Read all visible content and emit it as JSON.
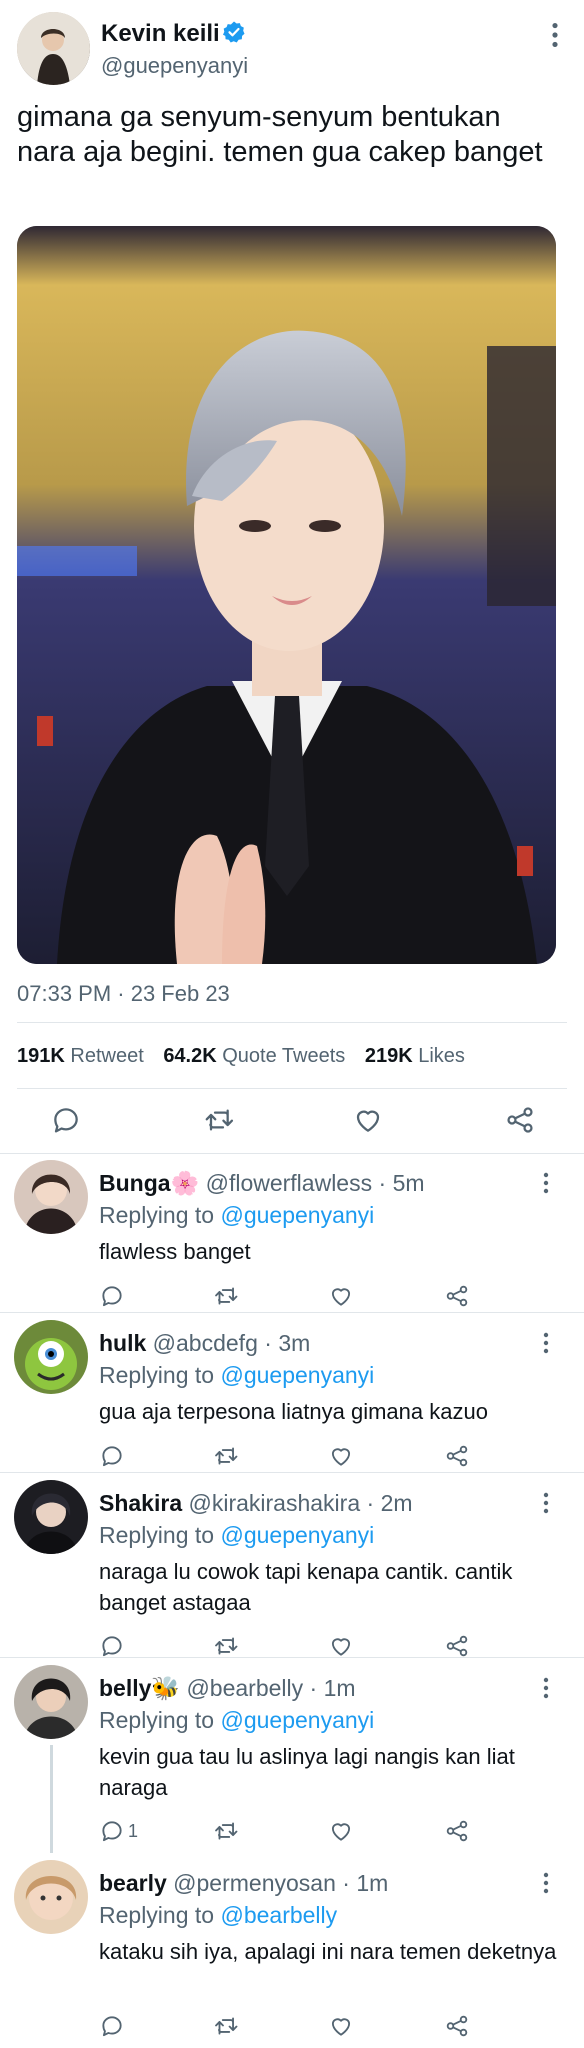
{
  "tweet": {
    "author_name": "Kevin keili",
    "author_handle": "@guepenyanyi",
    "text": "gimana ga senyum-senyum bentukan nara aja begini. temen gua cakep banget",
    "timestamp": "07:33 PM · 23 Feb 23",
    "stats": {
      "retweets": "191K",
      "retweets_label": "Retweet",
      "quotes": "64.2K",
      "quotes_label": "Quote Tweets",
      "likes": "219K",
      "likes_label": "Likes"
    }
  },
  "icons": {
    "reply": "reply-icon",
    "retweet": "retweet-icon",
    "like": "heart-icon",
    "share": "share-icon",
    "more": "more-icon",
    "verified": "verified-badge-icon"
  },
  "colors": {
    "accent": "#1d9bf0",
    "text": "#0f1419",
    "muted": "#536471",
    "divider": "#e1e6ea"
  },
  "replies": [
    {
      "name": "Bunga",
      "emoji": "🌸",
      "handle": "@flowerflawless",
      "time": "5m",
      "replying_label": "Replying to",
      "replying_to": "@guepenyanyi",
      "text": "flawless banget",
      "reply_count": ""
    },
    {
      "name": "hulk",
      "emoji": "",
      "handle": "@abcdefg",
      "time": "3m",
      "replying_label": "Replying to",
      "replying_to": "@guepenyanyi",
      "text": "gua aja terpesona liatnya gimana kazuo",
      "reply_count": ""
    },
    {
      "name": "Shakira",
      "emoji": "",
      "handle": "@kirakirashakira",
      "time": "2m",
      "replying_label": "Replying to",
      "replying_to": "@guepenyanyi",
      "text": "naraga lu cowok tapi kenapa cantik. cantik banget astagaa",
      "reply_count": ""
    },
    {
      "name": "belly",
      "emoji": "🐝",
      "handle": "@bearbelly",
      "time": "1m",
      "replying_label": "Replying to",
      "replying_to": "@guepenyanyi",
      "text": "kevin gua tau lu aslinya lagi nangis kan liat naraga",
      "reply_count": "1"
    },
    {
      "name": "bearly",
      "emoji": "",
      "handle": "@permenyosan",
      "time": "1m",
      "replying_label": "Replying to",
      "replying_to": "@bearbelly",
      "text": "kataku sih iya, apalagi ini nara temen deketnya",
      "reply_count": ""
    }
  ]
}
